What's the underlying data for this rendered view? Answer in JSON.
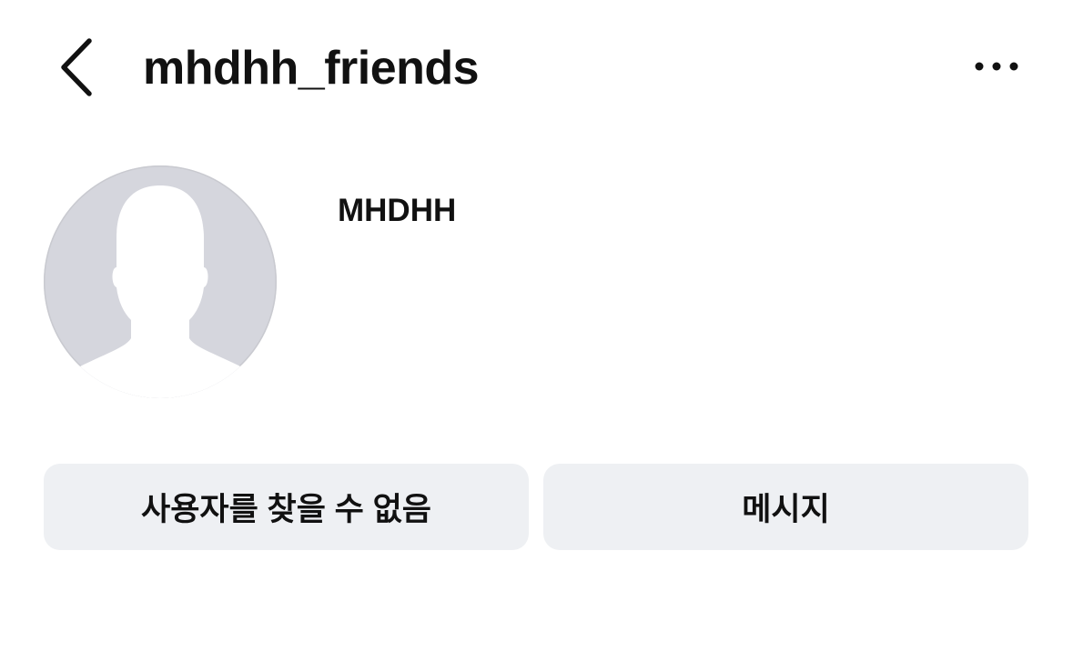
{
  "header": {
    "back_icon": "chevron-left-icon",
    "username": "mhdhh_friends",
    "more_icon": "more-horizontal-icon"
  },
  "profile": {
    "avatar_icon": "default-avatar-silhouette",
    "display_name": "MHDHH"
  },
  "actions": {
    "user_not_found_label": "사용자를 찾을 수 없음",
    "message_label": "메시지"
  },
  "colors": {
    "background": "#ffffff",
    "text": "#111111",
    "button_bg": "#eef0f3",
    "avatar_bg": "#d5d6dd",
    "avatar_silhouette": "#ffffff"
  }
}
